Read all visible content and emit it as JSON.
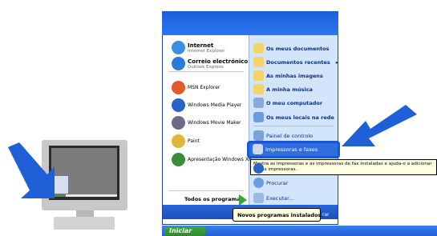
{
  "menu_left": {
    "pinned": [
      {
        "title": "Internet",
        "sub": "Internet Explorer",
        "icon": "internet-explorer-icon"
      },
      {
        "title": "Correio electrónico",
        "sub": "Outlook Express",
        "icon": "outlook-express-icon"
      }
    ],
    "recent": [
      {
        "label": "MSN Explorer",
        "icon": "msn-explorer-icon"
      },
      {
        "label": "Windows Media Player",
        "icon": "windows-media-player-icon"
      },
      {
        "label": "Windows Movie Maker",
        "icon": "windows-movie-maker-icon"
      },
      {
        "label": "Paint",
        "icon": "paint-icon"
      },
      {
        "label": "Apresentação Windows XP",
        "icon": "windows-xp-tour-icon"
      }
    ],
    "all_programs": "Todos os programas"
  },
  "menu_right": {
    "items": [
      {
        "label": "Os meus documentos",
        "bold": true,
        "icon": "my-documents-icon"
      },
      {
        "label": "Documentos recentes",
        "bold": true,
        "icon": "recent-documents-icon",
        "arrow": "▸"
      },
      {
        "label": "As minhas imagens",
        "bold": true,
        "icon": "my-pictures-icon"
      },
      {
        "label": "A minha música",
        "bold": true,
        "icon": "my-music-icon"
      },
      {
        "label": "O meu computador",
        "bold": true,
        "icon": "my-computer-icon"
      },
      {
        "label": "Os meus locais na rede",
        "bold": true,
        "icon": "my-network-icon"
      },
      {
        "label": "Painel de controlo",
        "bold": false,
        "icon": "control-panel-icon"
      },
      {
        "label": "Impressoras e faxes",
        "bold": false,
        "icon": "printers-faxes-icon"
      },
      {
        "label": "Procurar",
        "bold": false,
        "icon": "search-icon"
      },
      {
        "label": "Executar...",
        "bold": false,
        "icon": "run-icon"
      }
    ],
    "logoff_partial": "rar"
  },
  "tooltip": "Mostra as impressoras e as impressoras de fax instaladas e ajuda-o a adicionar novas impressoras.",
  "balloon": "Novos programas instalados.",
  "taskbar": {
    "start_label": "Iniciar"
  },
  "colors": {
    "arrow_blue": "#1f5fd8",
    "menu_blue": "#1d5ed7",
    "right_panel": "#d3e5fa",
    "start_green": "#3fa83a"
  }
}
